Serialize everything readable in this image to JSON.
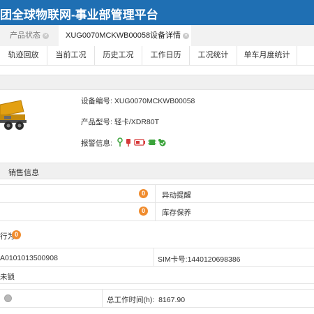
{
  "app": {
    "title": "团全球物联网-事业部管理平台"
  },
  "page_tabs": [
    {
      "label": "产品状态"
    },
    {
      "label": "XUG0070MCKWB00058设备详情"
    }
  ],
  "sub_tabs": [
    "轨迹回放",
    "当前工况",
    "历史工况",
    "工作日历",
    "工况统计",
    "单车月度统计"
  ],
  "device": {
    "id_label": "设备编号:",
    "id_value": "XUG0070MCKWB00058",
    "model_label": "产品型号:",
    "model_value": "轻卡/XDR80T",
    "alarm_label": "报警信息:"
  },
  "sales_section": {
    "title": "销售信息"
  },
  "status": {
    "badge1": "0",
    "anomaly_label": "异动提醒",
    "badge2": "0",
    "inventory_label": "库存保养",
    "behavior_text": "行为",
    "badge3": "0",
    "terminal_id": "A0101013500908",
    "sim_label": "SIM卡号:",
    "sim_value": "1440120698386",
    "lock_status": "未锁",
    "total_hours_label": "总工作时间(h):",
    "total_hours_value": "8167.90"
  },
  "colors": {
    "header_bg": "#1f6fb3",
    "badge": "#f08c2e"
  }
}
